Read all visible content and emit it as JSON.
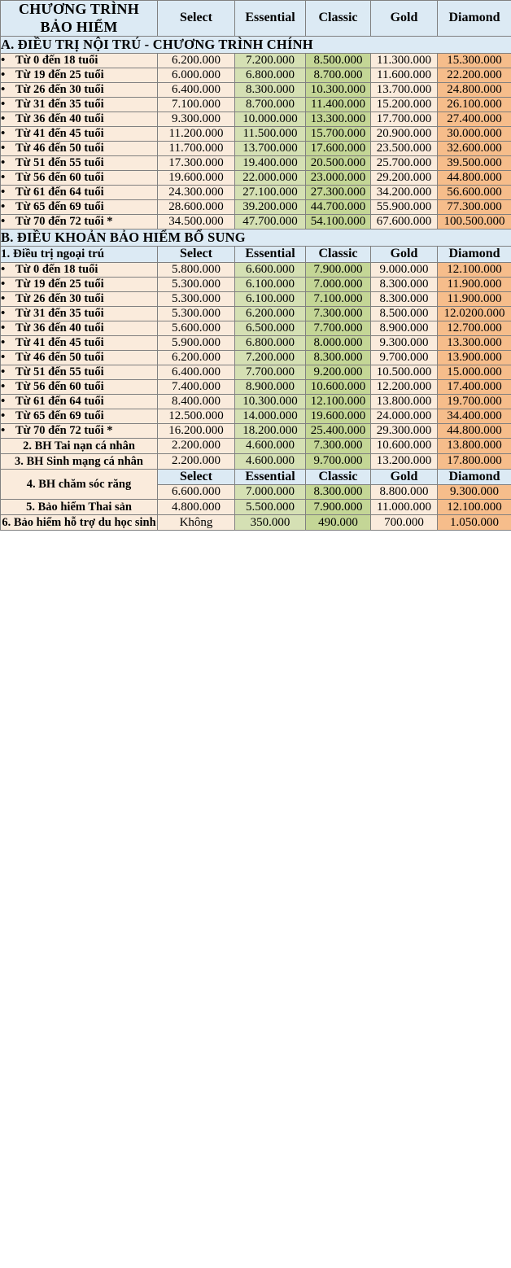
{
  "table": {
    "main_header": {
      "program_label": "CHƯƠNG TRÌNH BẢO HIỂM",
      "tiers": [
        "Select",
        "Essential",
        "Classic",
        "Gold",
        "Diamond"
      ]
    },
    "sections": [
      {
        "id": "A",
        "title": "A. ĐIỀU TRỊ NỘI TRÚ - CHƯƠNG TRÌNH CHÍNH",
        "rows": [
          {
            "label": "Từ 0 đến 18 tuổi",
            "values": [
              "6.200.000",
              "7.200.000",
              "8.500.000",
              "11.300.000",
              "15.300.000"
            ]
          },
          {
            "label": "Từ  19 đến 25 tuổi",
            "values": [
              "6.000.000",
              "6.800.000",
              "8.700.000",
              "11.600.000",
              "22.200.000"
            ]
          },
          {
            "label": "Từ 26 đến 30 tuổi",
            "values": [
              "6.400.000",
              "8.300.000",
              "10.300.000",
              "13.700.000",
              "24.800.000"
            ]
          },
          {
            "label": "Từ 31 đến 35 tuổi",
            "values": [
              "7.100.000",
              "8.700.000",
              "11.400.000",
              "15.200.000",
              "26.100.000"
            ]
          },
          {
            "label": "Từ 36 đến 40 tuổi",
            "values": [
              "9.300.000",
              "10.000.000",
              "13.300.000",
              "17.700.000",
              "27.400.000"
            ]
          },
          {
            "label": "Từ 41 đến 45 tuổi",
            "values": [
              "11.200.000",
              "11.500.000",
              "15.700.000",
              "20.900.000",
              "30.000.000"
            ]
          },
          {
            "label": "Từ 46 đến 50 tuổi",
            "values": [
              "11.700.000",
              "13.700.000",
              "17.600.000",
              "23.500.000",
              "32.600.000"
            ]
          },
          {
            "label": "Từ 51 đến 55 tuổi",
            "values": [
              "17.300.000",
              "19.400.000",
              "20.500.000",
              "25.700.000",
              "39.500.000"
            ]
          },
          {
            "label": "Từ 56 đến 60 tuổi",
            "values": [
              "19.600.000",
              "22.000.000",
              "23.000.000",
              "29.200.000",
              "44.800.000"
            ]
          },
          {
            "label": "Từ 61 đến 64 tuổi",
            "values": [
              "24.300.000",
              "27.100.000",
              "27.300.000",
              "34.200.000",
              "56.600.000"
            ]
          },
          {
            "label": "Từ 65 đến 69 tuổi",
            "values": [
              "28.600.000",
              "39.200.000",
              "44.700.000",
              "55.900.000",
              "77.300.000"
            ]
          },
          {
            "label": "Từ 70 đến 72 tuổi *",
            "values": [
              "34.500.000",
              "47.700.000",
              "54.100.000",
              "67.600.000",
              "100.500.000"
            ]
          }
        ]
      },
      {
        "id": "B",
        "title": "B. ĐIỀU KHOẢN BẢO HIỂM BỔ SUNG",
        "subheader_label": "1. Điều trị ngoại trú",
        "rows": [
          {
            "label": "Từ 0 đến 18 tuổi",
            "values": [
              "5.800.000",
              "6.600.000",
              "7.900.000",
              "9.000.000",
              "12.100.000"
            ]
          },
          {
            "label": "Từ  19 đến 25 tuổi",
            "values": [
              "5.300.000",
              "6.100.000",
              "7.000.000",
              "8.300.000",
              "11.900.000"
            ]
          },
          {
            "label": "Từ 26 đến 30 tuổi",
            "values": [
              "5.300.000",
              "6.100.000",
              "7.100.000",
              "8.300.000",
              "11.900.000"
            ]
          },
          {
            "label": "Từ 31 đến 35 tuổi",
            "values": [
              "5.300.000",
              "6.200.000",
              "7.300.000",
              "8.500.000",
              "12.0200.000"
            ]
          },
          {
            "label": "Từ 36 đến 40 tuổi",
            "values": [
              "5.600.000",
              "6.500.000",
              "7.700.000",
              "8.900.000",
              "12.700.000"
            ]
          },
          {
            "label": "Từ 41 đến 45 tuổi",
            "values": [
              "5.900.000",
              "6.800.000",
              "8.000.000",
              "9.300.000",
              "13.300.000"
            ]
          },
          {
            "label": "Từ 46 đến 50 tuổi",
            "values": [
              "6.200.000",
              "7.200.000",
              "8.300.000",
              "9.700.000",
              "13.900.000"
            ]
          },
          {
            "label": "Từ 51 đến 55 tuổi",
            "values": [
              "6.400.000",
              "7.700.000",
              "9.200.000",
              "10.500.000",
              "15.000.000"
            ]
          },
          {
            "label": "Từ 56 đến 60 tuổi",
            "values": [
              "7.400.000",
              "8.900.000",
              "10.600.000",
              "12.200.000",
              "17.400.000"
            ]
          },
          {
            "label": "Từ 61 đến 64 tuổi",
            "values": [
              "8.400.000",
              "10.300.000",
              "12.100.000",
              "13.800.000",
              "19.700.000"
            ]
          },
          {
            "label": "Từ 65 đến 69 tuổi",
            "values": [
              "12.500.000",
              "14.000.000",
              "19.600.000",
              "24.000.000",
              "34.400.000"
            ]
          },
          {
            "label": "Từ 70 đến 72 tuổi *",
            "values": [
              "16.200.000",
              "18.200.000",
              "25.400.000",
              "29.300.000",
              "44.800.000"
            ]
          }
        ],
        "benefits": [
          {
            "label": "2. BH Tai nạn cá nhân",
            "values": [
              "2.200.000",
              "4.600.000",
              "7.300.000",
              "10.600.000",
              "13.800.000"
            ]
          },
          {
            "label": "3. BH Sinh mạng cá nhân",
            "values": [
              "2.200.000",
              "4.600.000",
              "9.700.000",
              "13.200.000",
              "17.800.000"
            ]
          }
        ],
        "dental": {
          "label": "4. BH chăm sóc răng",
          "tiers": [
            "Select",
            "Essential",
            "Classic",
            "Gold",
            "Diamond"
          ],
          "values": [
            "6.600.000",
            "7.000.000",
            "8.300.000",
            "8.800.000",
            "9.300.000"
          ]
        },
        "benefits_tail": [
          {
            "label": "5. Bảo hiểm Thai sản",
            "values": [
              "4.800.000",
              "5.500.000",
              "7.900.000",
              "11.000.000",
              "12.100.000"
            ]
          },
          {
            "label": "6. Bảo hiểm hỗ trợ du học sinh",
            "values": [
              "Không",
              "350.000",
              "490.000",
              "700.000",
              "1.050.000"
            ]
          }
        ]
      }
    ],
    "bullet_glyph": "•"
  },
  "colors": {
    "header_blue": "#dceaf4",
    "cream": "#faebdc",
    "green_light": "#d5e0b4",
    "green_dark": "#c4d696",
    "orange": "#f6bd8b"
  }
}
